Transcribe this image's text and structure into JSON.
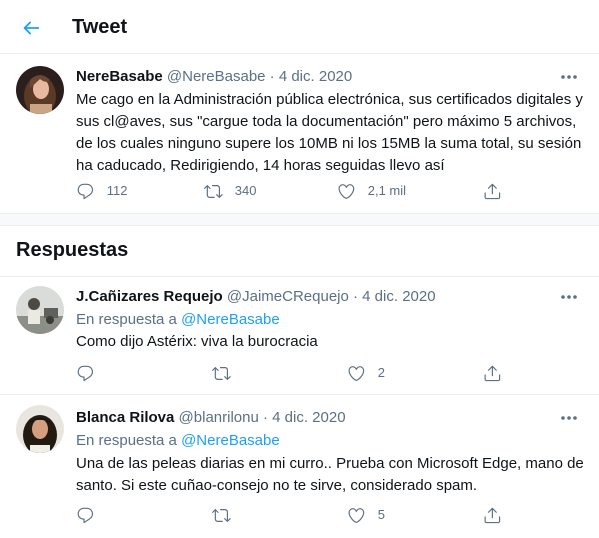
{
  "header": {
    "title": "Tweet",
    "back_icon": "arrow-left-icon",
    "accent": "#1da1f2"
  },
  "main_tweet": {
    "author_name": "NereBasabe",
    "meta": "@NereBasabe · 4 dic. 2020",
    "text": "Me cago en la Administración pública electrónica, sus certificados digitales y sus cl@aves, sus \"cargue toda la documentación\" pero máximo 5 archivos, de los cuales ninguno supere los 10MB ni los 15MB la suma total, su sesión ha caducado, Redirigiendo, 14 horas seguidas llevo así",
    "replies": "112",
    "retweets": "340",
    "likes": "2,1 mil"
  },
  "section": {
    "title": "Respuestas"
  },
  "replies": [
    {
      "author_name": "J.Cañizares Requejo",
      "meta": "@JaimeCRequejo · 4 dic. 2020",
      "reply_prefix": "En respuesta a",
      "reply_to": "@NereBasabe",
      "text": "Como dijo Astérix: viva la burocracia",
      "likes": "2"
    },
    {
      "author_name": "Blanca Rilova",
      "meta": "@blanrilonu · 4 dic. 2020",
      "reply_prefix": "En respuesta a",
      "reply_to": "@NereBasabe",
      "text": "Una de las peleas diarias en mi curro.. Prueba con Microsoft Edge, mano de santo. Si este cuñao-consejo no te sirve, considerado spam.",
      "likes": "5"
    }
  ],
  "colors": {
    "text": "#0f1419",
    "muted": "#5b7083",
    "link": "#1da1f2",
    "border": "#ebeef0",
    "separator": "#f7f9fa"
  }
}
